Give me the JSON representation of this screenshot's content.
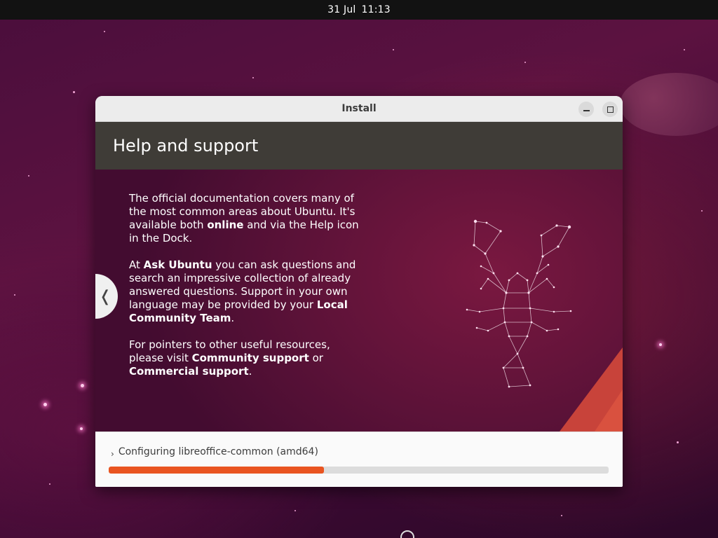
{
  "topbar": {
    "date": "31 Jul",
    "time": "11:13"
  },
  "window": {
    "title": "Install"
  },
  "header": {
    "title": "Help and support"
  },
  "slide": {
    "p1_a": "The official documentation covers many of the most common areas about Ubuntu. It's available both ",
    "p1_b": "online",
    "p1_c": " and via the Help icon in the Dock.",
    "p2_a": "At ",
    "p2_b": "Ask Ubuntu",
    "p2_c": " you can ask questions and search an impressive collection of already answered questions. Support in your own language may be provided by your ",
    "p2_d": "Local Community Team",
    "p2_e": ".",
    "p3_a": "For pointers to other useful resources, please visit ",
    "p3_b": "Community support",
    "p3_c": " or ",
    "p3_d": "Commercial support",
    "p3_e": ".",
    "prev_glyph": "❬"
  },
  "progress": {
    "status_glyph": "›",
    "status": "Configuring libreoffice-common (amd64)",
    "value_percent": 43,
    "color": "#e95420"
  },
  "icons": [
    "minimize-icon",
    "maximize-icon",
    "chevron-left-icon",
    "chevron-right-icon",
    "lobster-constellation-icon"
  ]
}
